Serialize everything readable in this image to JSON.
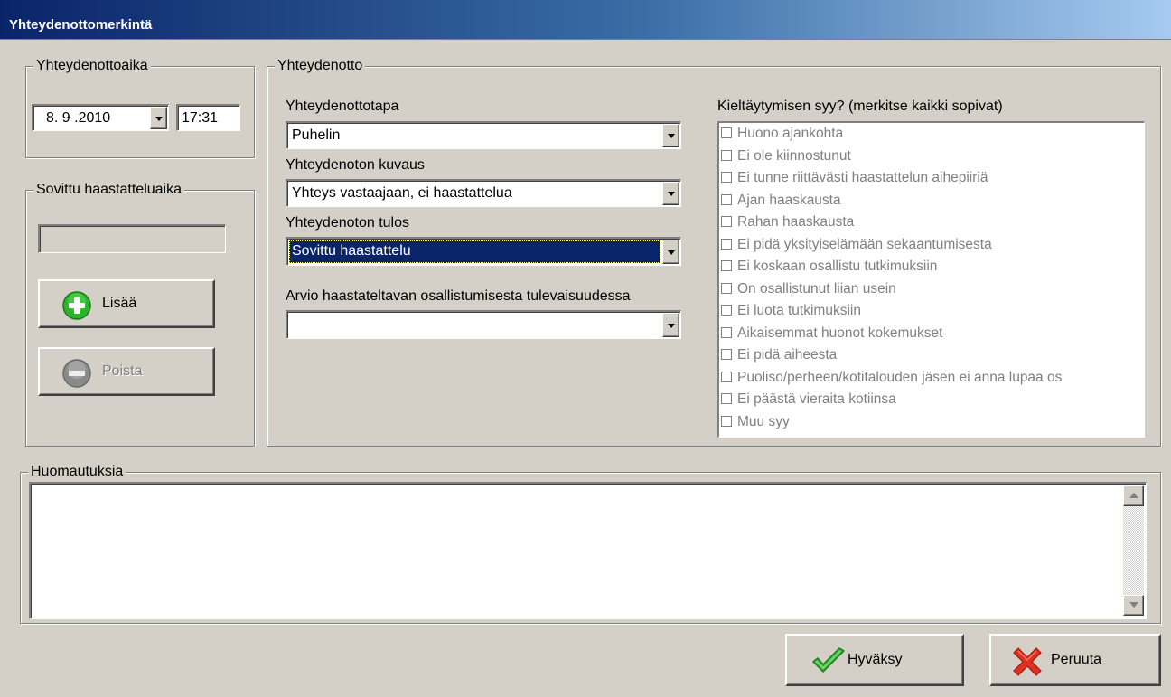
{
  "window": {
    "title": "Yhteydenottomerkintä"
  },
  "contact_time": {
    "legend": "Yhteydenottoaika",
    "date": "8. 9 .2010",
    "time": "17:31"
  },
  "agreed_interview": {
    "legend": "Sovittu haastatteluaika",
    "value": "",
    "add_label": "Lisää",
    "remove_label": "Poista"
  },
  "contact": {
    "legend": "Yhteydenotto",
    "method_label": "Yhteydenottotapa",
    "method_value": "Puhelin",
    "description_label": "Yhteydenoton kuvaus",
    "description_value": "Yhteys vastaajaan, ei haastattelua",
    "result_label": "Yhteydenoton tulos",
    "result_value": "Sovittu haastattelu",
    "future_label": "Arvio haastateltavan osallistumisesta tulevaisuudessa",
    "future_value": "",
    "refusal_label": "Kieltäytymisen syy? (merkitse kaikki sopivat)",
    "refusal_reasons": [
      "Huono ajankohta",
      "Ei ole kiinnostunut",
      "Ei tunne riittävästi haastattelun aihepiiriä",
      "Ajan haaskausta",
      "Rahan haaskausta",
      "Ei pidä yksityiselämään sekaantumisesta",
      "Ei koskaan osallistu tutkimuksiin",
      "On osallistunut liian usein",
      "Ei luota tutkimuksiin",
      "Aikaisemmat huonot kokemukset",
      "Ei pidä aiheesta",
      "Puoliso/perheen/kotitalouden jäsen ei anna lupaa os",
      "Ei päästä vieraita kotiinsa",
      "Muu syy"
    ]
  },
  "notes": {
    "legend": "Huomautuksia",
    "value": ""
  },
  "footer": {
    "accept_label": "Hyväksy",
    "cancel_label": "Peruuta"
  },
  "colors": {
    "face": "#d4d0c8",
    "titlebar_start": "#0a246a",
    "selection": "#0a246a",
    "add_icon": "#2bb52b",
    "accept_icon": "#3cb83c",
    "cancel_icon": "#e03020"
  }
}
